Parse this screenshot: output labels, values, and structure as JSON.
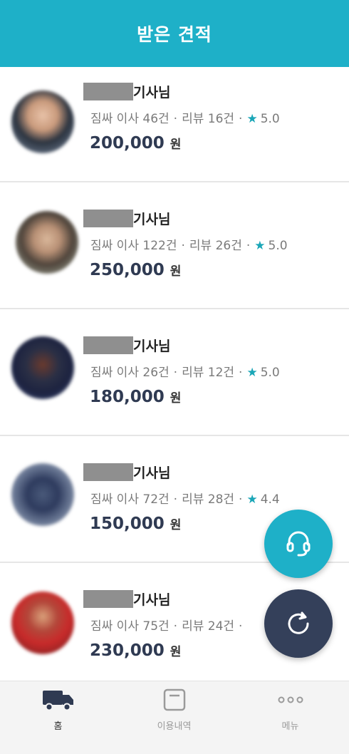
{
  "header": {
    "title": "받은 견적"
  },
  "labels": {
    "stats_prefix": "짐싸 이사",
    "review_prefix": "리뷰",
    "count_unit": "건",
    "dot": "·",
    "currency": "원",
    "name_suffix": "기사님"
  },
  "quotes": [
    {
      "moves": "46",
      "reviews": "16",
      "rating": "5.0",
      "price": "200,000"
    },
    {
      "moves": "122",
      "reviews": "26",
      "rating": "5.0",
      "price": "250,000"
    },
    {
      "moves": "26",
      "reviews": "12",
      "rating": "5.0",
      "price": "180,000"
    },
    {
      "moves": "72",
      "reviews": "28",
      "rating": "4.4",
      "price": "150,000"
    },
    {
      "moves": "75",
      "reviews": "24",
      "rating": "",
      "price": "230,000"
    }
  ],
  "fab": {
    "support_icon": "headset-icon",
    "refresh_icon": "refresh-icon"
  },
  "bottom_nav": [
    {
      "label": "홈",
      "icon": "truck-icon",
      "active": true
    },
    {
      "label": "이용내역",
      "icon": "history-icon",
      "active": false
    },
    {
      "label": "메뉴",
      "icon": "more-icon",
      "active": false
    }
  ],
  "colors": {
    "brand": "#1eb0c8",
    "dark": "#34405a",
    "star": "#1aa6b7",
    "price": "#2f3a52"
  }
}
